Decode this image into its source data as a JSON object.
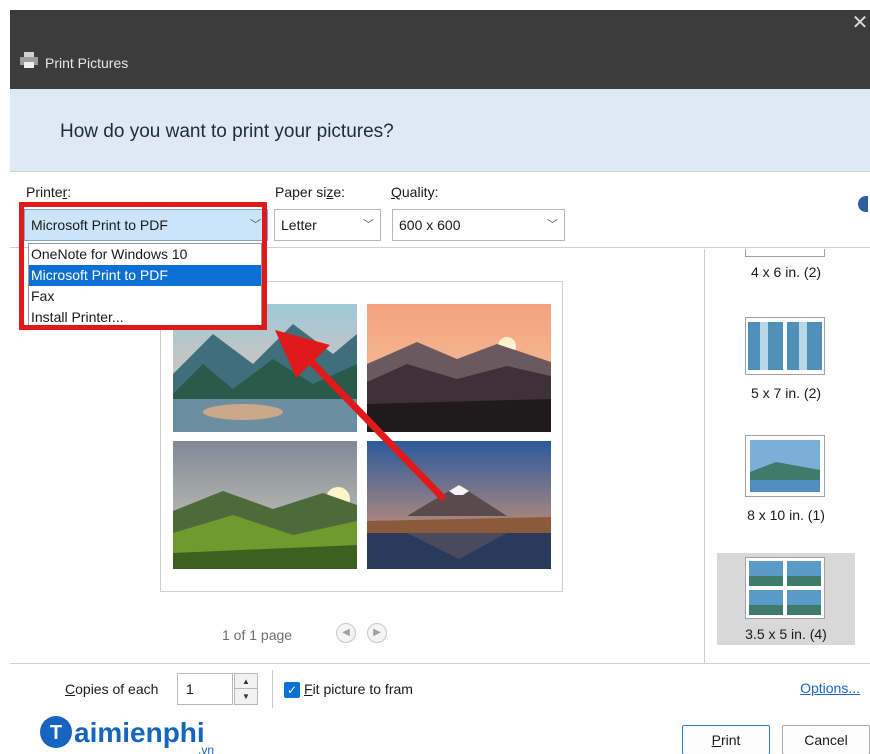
{
  "window": {
    "title": "Print Pictures",
    "close_glyph": "✕"
  },
  "header": {
    "question": "How do you want to print your pictures?"
  },
  "printer": {
    "label_pre": "Printe",
    "label_mnemonic": "r",
    "label_post": ":",
    "value": "Microsoft Print to PDF",
    "options": [
      "OneNote for Windows 10",
      "Microsoft Print to PDF",
      "Fax",
      "Install Printer..."
    ],
    "highlighted_index": 1
  },
  "paper_size": {
    "label_pre": "Paper si",
    "label_mnemonic": "z",
    "label_post": "e:",
    "value": "Letter"
  },
  "quality": {
    "label_mnemonic": "Q",
    "label_post": "uality:",
    "value": "600 x 600"
  },
  "preview": {
    "pager_text": "1 of 1 page",
    "prev_icon": "◀",
    "next_icon": "▶",
    "pictures": [
      "lake-mountains-sunrise",
      "misty-mountains-sunset",
      "green-hills-sunburst",
      "volcano-lake-reflection"
    ]
  },
  "layouts": [
    {
      "caption": "4 x 6 in. (2)"
    },
    {
      "caption": "5 x 7 in. (2)"
    },
    {
      "caption": "8 x 10 in. (1)"
    },
    {
      "caption": "3.5 x 5 in. (4)",
      "selected": true
    }
  ],
  "bottom": {
    "copies_label_mnemonic": "C",
    "copies_label_post": "opies of each",
    "copies_value": "1",
    "fit_checked": true,
    "fit_mnemonic": "F",
    "fit_label_post": "it picture to fram",
    "options_link": "Options...",
    "print_mnemonic": "P",
    "print_post": "rint",
    "cancel_label": "Cancel"
  },
  "watermark": {
    "brand": "aimienphi",
    "brand_initial": "T",
    "suffix": ".vn"
  },
  "colors": {
    "titlebar": "#3c3c3c",
    "header": "#dde9f4",
    "highlight": "#0b6fd4",
    "annotation": "#e01a1a",
    "link": "#1a66c9"
  }
}
